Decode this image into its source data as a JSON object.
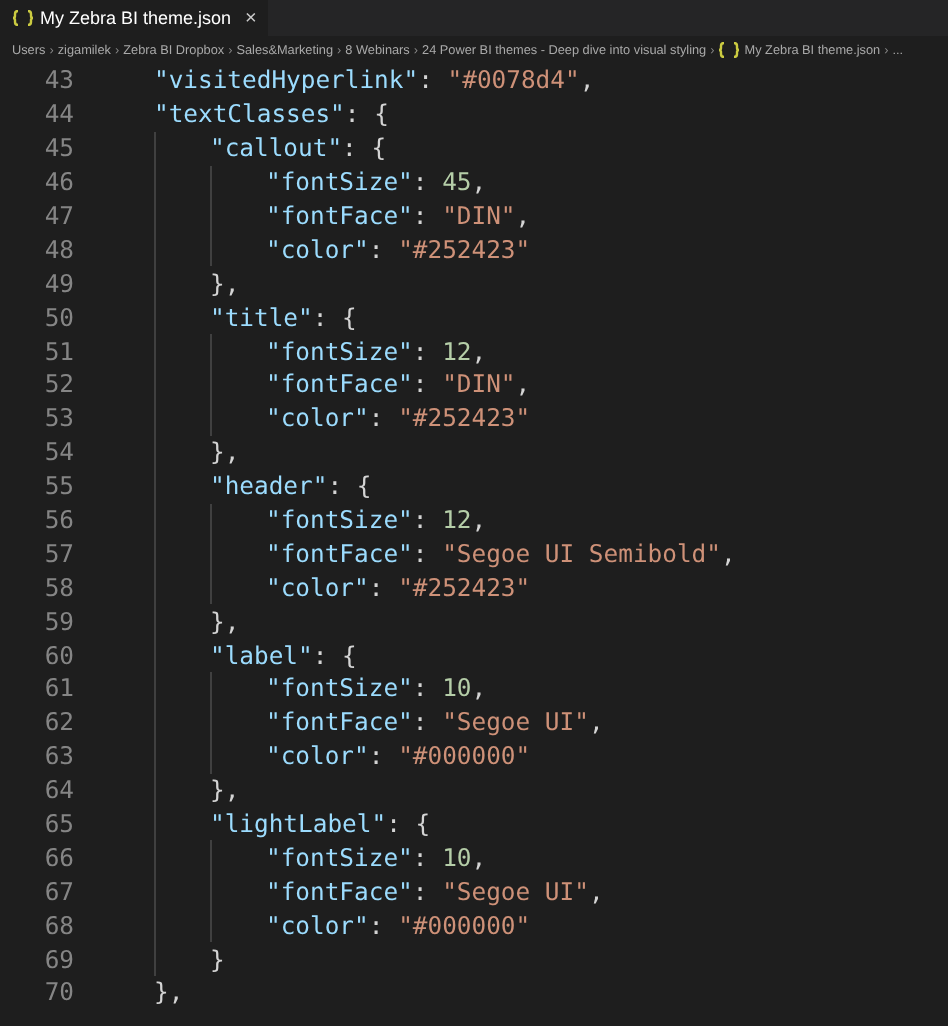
{
  "tab": {
    "label": "My Zebra BI theme.json",
    "selected": true,
    "close": "×"
  },
  "breadcrumb_separator": "›",
  "breadcrumbs": [
    {
      "label": "Users"
    },
    {
      "label": "zigamilek"
    },
    {
      "label": "Zebra BI Dropbox"
    },
    {
      "label": "Sales&Marketing"
    },
    {
      "label": "8 Webinars"
    },
    {
      "label": "24 Power BI themes - Deep dive into visual styling"
    },
    {
      "label": "My Zebra BI theme.json",
      "kind": "file"
    },
    {
      "label": "...",
      "kind": "more"
    }
  ],
  "lines": [
    {
      "number": "43",
      "tokens": [
        {
          "kind": "key",
          "text": "\"visitedHyperlink\""
        },
        {
          "kind": "punct",
          "text": ": "
        },
        {
          "kind": "string",
          "text": "\"#0078d4\""
        },
        {
          "kind": "punct",
          "text": ","
        }
      ]
    },
    {
      "number": "44",
      "tokens": [
        {
          "kind": "key",
          "text": "\"textClasses\""
        },
        {
          "kind": "punct",
          "text": ": {"
        }
      ],
      "children": [
        {
          "number": "45",
          "tokens": [
            {
              "kind": "key",
              "text": "\"callout\""
            },
            {
              "kind": "punct",
              "text": ": {"
            }
          ],
          "children": [
            {
              "number": "46",
              "tokens": [
                {
                  "kind": "key",
                  "text": "\"fontSize\""
                },
                {
                  "kind": "punct",
                  "text": ": "
                },
                {
                  "kind": "number",
                  "text": "45"
                },
                {
                  "kind": "punct",
                  "text": ","
                }
              ]
            },
            {
              "number": "47",
              "tokens": [
                {
                  "kind": "key",
                  "text": "\"fontFace\""
                },
                {
                  "kind": "punct",
                  "text": ": "
                },
                {
                  "kind": "string",
                  "text": "\"DIN\""
                },
                {
                  "kind": "punct",
                  "text": ","
                }
              ]
            },
            {
              "number": "48",
              "tokens": [
                {
                  "kind": "key",
                  "text": "\"color\""
                },
                {
                  "kind": "punct",
                  "text": ": "
                },
                {
                  "kind": "string",
                  "text": "\"#252423\""
                }
              ]
            }
          ]
        },
        {
          "number": "49",
          "tokens": [
            {
              "kind": "punct",
              "text": "},"
            }
          ]
        },
        {
          "number": "50",
          "tokens": [
            {
              "kind": "key",
              "text": "\"title\""
            },
            {
              "kind": "punct",
              "text": ": {"
            }
          ],
          "children": [
            {
              "number": "51",
              "tokens": [
                {
                  "kind": "key",
                  "text": "\"fontSize\""
                },
                {
                  "kind": "punct",
                  "text": ": "
                },
                {
                  "kind": "number",
                  "text": "12"
                },
                {
                  "kind": "punct",
                  "text": ","
                }
              ]
            },
            {
              "number": "52",
              "tokens": [
                {
                  "kind": "key",
                  "text": "\"fontFace\""
                },
                {
                  "kind": "punct",
                  "text": ": "
                },
                {
                  "kind": "string",
                  "text": "\"DIN\""
                },
                {
                  "kind": "punct",
                  "text": ","
                }
              ]
            },
            {
              "number": "53",
              "tokens": [
                {
                  "kind": "key",
                  "text": "\"color\""
                },
                {
                  "kind": "punct",
                  "text": ": "
                },
                {
                  "kind": "string",
                  "text": "\"#252423\""
                }
              ]
            }
          ]
        },
        {
          "number": "54",
          "tokens": [
            {
              "kind": "punct",
              "text": "},"
            }
          ]
        },
        {
          "number": "55",
          "tokens": [
            {
              "kind": "key",
              "text": "\"header\""
            },
            {
              "kind": "punct",
              "text": ": {"
            }
          ],
          "children": [
            {
              "number": "56",
              "tokens": [
                {
                  "kind": "key",
                  "text": "\"fontSize\""
                },
                {
                  "kind": "punct",
                  "text": ": "
                },
                {
                  "kind": "number",
                  "text": "12"
                },
                {
                  "kind": "punct",
                  "text": ","
                }
              ]
            },
            {
              "number": "57",
              "tokens": [
                {
                  "kind": "key",
                  "text": "\"fontFace\""
                },
                {
                  "kind": "punct",
                  "text": ": "
                },
                {
                  "kind": "string",
                  "text": "\"Segoe UI Semibold\""
                },
                {
                  "kind": "punct",
                  "text": ","
                }
              ]
            },
            {
              "number": "58",
              "tokens": [
                {
                  "kind": "key",
                  "text": "\"color\""
                },
                {
                  "kind": "punct",
                  "text": ": "
                },
                {
                  "kind": "string",
                  "text": "\"#252423\""
                }
              ]
            }
          ]
        },
        {
          "number": "59",
          "tokens": [
            {
              "kind": "punct",
              "text": "},"
            }
          ]
        },
        {
          "number": "60",
          "tokens": [
            {
              "kind": "key",
              "text": "\"label\""
            },
            {
              "kind": "punct",
              "text": ": {"
            }
          ],
          "children": [
            {
              "number": "61",
              "tokens": [
                {
                  "kind": "key",
                  "text": "\"fontSize\""
                },
                {
                  "kind": "punct",
                  "text": ": "
                },
                {
                  "kind": "number",
                  "text": "10"
                },
                {
                  "kind": "punct",
                  "text": ","
                }
              ]
            },
            {
              "number": "62",
              "tokens": [
                {
                  "kind": "key",
                  "text": "\"fontFace\""
                },
                {
                  "kind": "punct",
                  "text": ": "
                },
                {
                  "kind": "string",
                  "text": "\"Segoe UI\""
                },
                {
                  "kind": "punct",
                  "text": ","
                }
              ]
            },
            {
              "number": "63",
              "tokens": [
                {
                  "kind": "key",
                  "text": "\"color\""
                },
                {
                  "kind": "punct",
                  "text": ": "
                },
                {
                  "kind": "string",
                  "text": "\"#000000\""
                }
              ]
            }
          ]
        },
        {
          "number": "64",
          "tokens": [
            {
              "kind": "punct",
              "text": "},"
            }
          ]
        },
        {
          "number": "65",
          "tokens": [
            {
              "kind": "key",
              "text": "\"lightLabel\""
            },
            {
              "kind": "punct",
              "text": ": {"
            }
          ],
          "children": [
            {
              "number": "66",
              "tokens": [
                {
                  "kind": "key",
                  "text": "\"fontSize\""
                },
                {
                  "kind": "punct",
                  "text": ": "
                },
                {
                  "kind": "number",
                  "text": "10"
                },
                {
                  "kind": "punct",
                  "text": ","
                }
              ]
            },
            {
              "number": "67",
              "tokens": [
                {
                  "kind": "key",
                  "text": "\"fontFace\""
                },
                {
                  "kind": "punct",
                  "text": ": "
                },
                {
                  "kind": "string",
                  "text": "\"Segoe UI\""
                },
                {
                  "kind": "punct",
                  "text": ","
                }
              ]
            },
            {
              "number": "68",
              "tokens": [
                {
                  "kind": "key",
                  "text": "\"color\""
                },
                {
                  "kind": "punct",
                  "text": ": "
                },
                {
                  "kind": "string",
                  "text": "\"#000000\""
                }
              ]
            }
          ]
        },
        {
          "number": "69",
          "tokens": [
            {
              "kind": "punct",
              "text": "}"
            }
          ]
        }
      ]
    },
    {
      "number": "70",
      "tokens": [
        {
          "kind": "punct",
          "text": "},"
        }
      ]
    }
  ]
}
